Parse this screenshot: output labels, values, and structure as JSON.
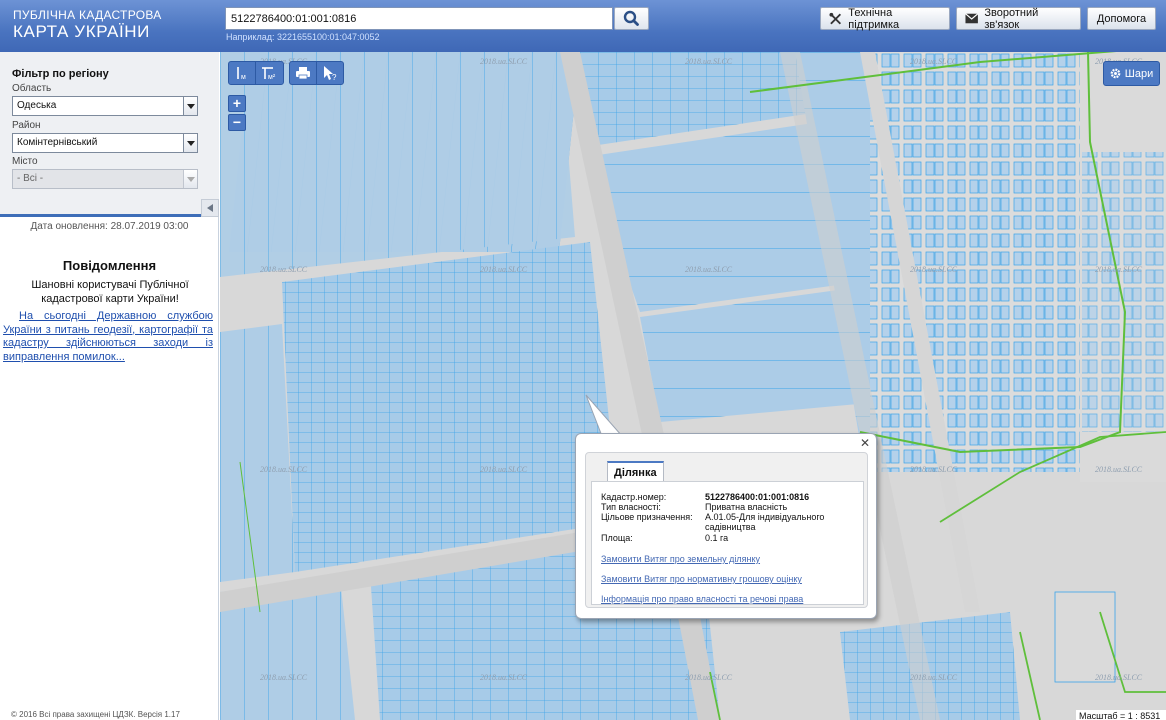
{
  "header": {
    "logo_line1": "ПУБЛІЧНА КАДАСТРОВА",
    "logo_line2": "КАРТА УКРАЇНИ",
    "search_value": "5122786400:01:001:0816",
    "search_hint": "Наприклад: 3221655100:01:047:0052",
    "buttons": {
      "support": "Технічна підтримка",
      "feedback": "Зворотний зв'язок",
      "help": "Допомога"
    }
  },
  "sidebar": {
    "filter_title": "Фільтр по регіону",
    "region_label": "Область",
    "region_value": "Одеська",
    "district_label": "Район",
    "district_value": "Комінтернівський",
    "city_label": "Місто",
    "city_value": "- Всі -",
    "update_date": "Дата оновлення: 28.07.2019 03:00",
    "notice_title": "Повідомлення",
    "notice_greeting": "Шановні користувачі Публічної кадастрової карти України!",
    "notice_link": "На сьогодні Державною службою України з питань геодезії, картографії та кадастру здійснюються заходи із виправлення помилок...",
    "copyright": "© 2016 Всі права захищені ЦДЗК. Версія 1.17"
  },
  "map": {
    "layers_label": "Шари",
    "zoom_in": "+",
    "zoom_out": "−",
    "tool_line_sub": "м",
    "tool_area_sub": "м²",
    "watermark": "2018.ua.SLCC",
    "scale": "Масштаб = 1 : 8531"
  },
  "popup": {
    "tab_label": "Ділянка",
    "fields": [
      {
        "label": "Кадастр.номер:",
        "value": "5122786400:01:001:0816"
      },
      {
        "label": "Тип власності:",
        "value": "Приватна власність"
      },
      {
        "label": "Цільове призначення:",
        "value": "А.01.05-Для індивідуального садівництва"
      },
      {
        "label": "Площа:",
        "value": "0.1 га"
      }
    ],
    "links": [
      "Замовити Витяг про земельну ділянку",
      "Замовити Витяг про нормативну грошову оцінку",
      "Інформація про право власності та речові права"
    ]
  },
  "colors": {
    "header_blue": "#4a74c0",
    "parcel_fill": "#a7cbe8",
    "parcel_stroke": "#3aa3ea",
    "boundary_green": "#5fbf3b",
    "road_gray": "#cfcfcf"
  }
}
